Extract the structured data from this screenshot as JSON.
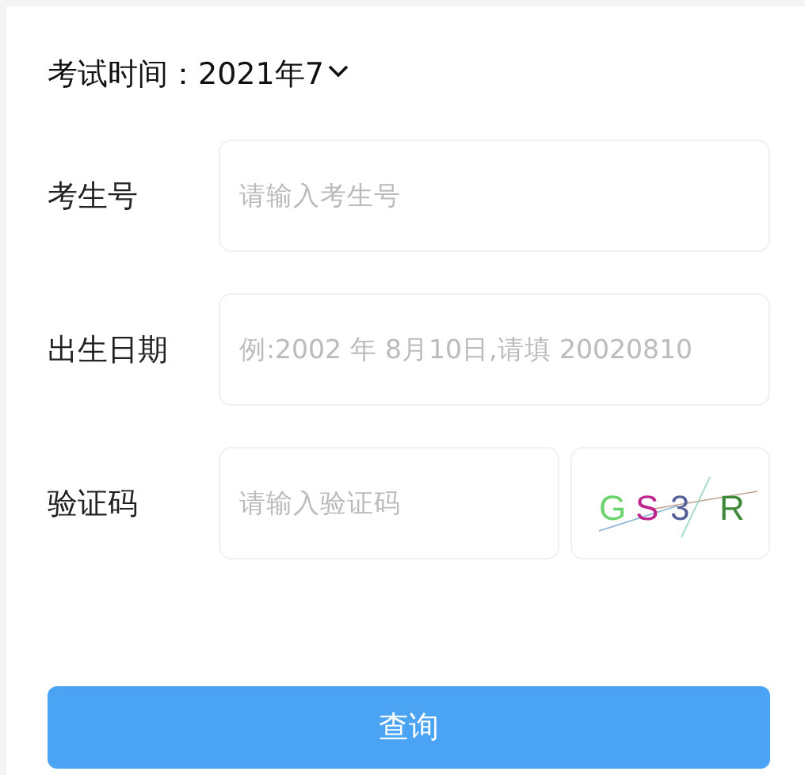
{
  "exam_time": {
    "label": "考试时间：",
    "value": "2021年7"
  },
  "fields": [
    {
      "kind": "input",
      "label": "考生号",
      "placeholder": "请输入考生号"
    },
    {
      "kind": "input",
      "label": "出生日期",
      "placeholder": "例:2002 年 8月10日,请填 20020810"
    },
    {
      "kind": "captcha",
      "label": "验证码",
      "placeholder": "请输入验证码",
      "captcha": [
        {
          "text": "G",
          "color": "#6ad46a"
        },
        {
          "text": "S",
          "color": "#c0258f"
        },
        {
          "text": "3",
          "color": "#55629a"
        },
        {
          "text": "R",
          "color": "#3f8a3a"
        }
      ]
    }
  ],
  "submit": "查询"
}
